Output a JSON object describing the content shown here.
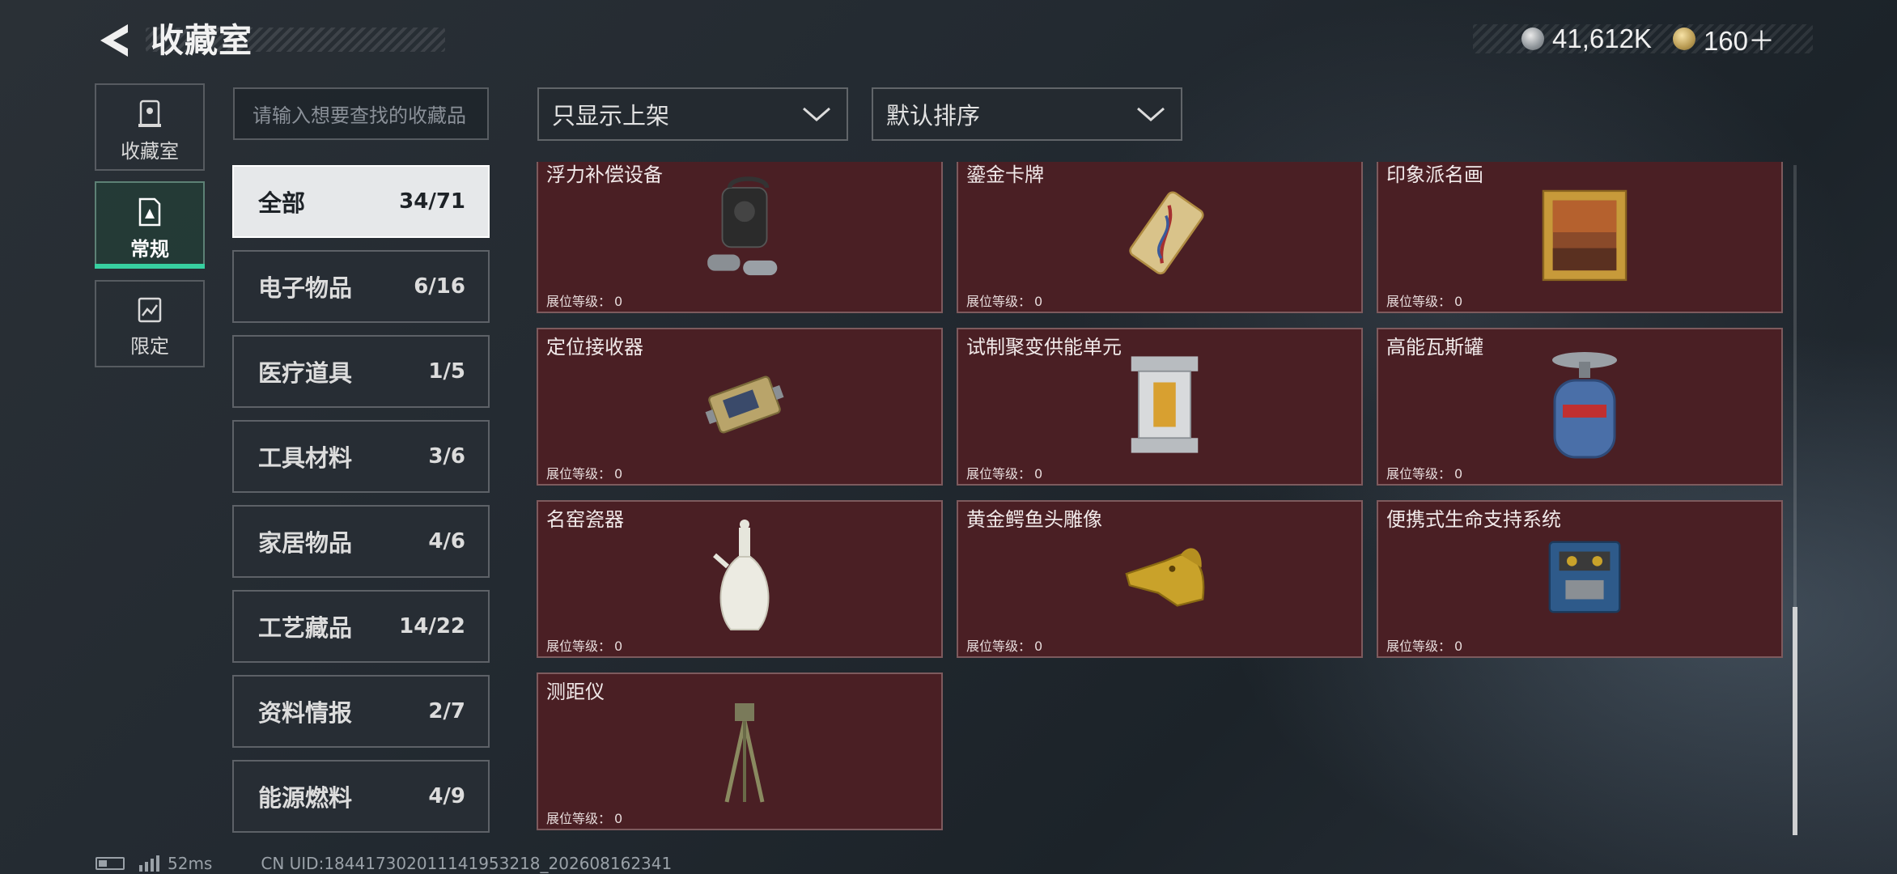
{
  "header": {
    "title": "收藏室",
    "currency": [
      {
        "icon": "silver-coin-icon",
        "value": "41,612K"
      },
      {
        "icon": "gold-coin-icon",
        "value": "160＋"
      }
    ]
  },
  "left_nav": [
    {
      "id": "collection",
      "label": "收藏室",
      "icon": "collection-icon"
    },
    {
      "id": "regular",
      "label": "常规",
      "icon": "regular-icon",
      "active": true
    },
    {
      "id": "limited",
      "label": "限定",
      "icon": "limited-icon"
    }
  ],
  "search": {
    "placeholder": "请输入想要查找的收藏品"
  },
  "filters": {
    "display": "只显示上架",
    "sort": "默认排序"
  },
  "categories": [
    {
      "name": "全部",
      "count": "34/71",
      "active": true
    },
    {
      "name": "电子物品",
      "count": "6/16"
    },
    {
      "name": "医疗道具",
      "count": "1/5"
    },
    {
      "name": "工具材料",
      "count": "3/6"
    },
    {
      "name": "家居物品",
      "count": "4/6"
    },
    {
      "name": "工艺藏品",
      "count": "14/22"
    },
    {
      "name": "资料情报",
      "count": "2/7"
    },
    {
      "name": "能源燃料",
      "count": "4/9"
    }
  ],
  "level_label": "展位等级：",
  "items": [
    {
      "name": "浮力补偿设备",
      "level": "0",
      "icon": "buoyancy-compensator-icon"
    },
    {
      "name": "鎏金卡牌",
      "level": "0",
      "icon": "gilded-card-icon"
    },
    {
      "name": "印象派名画",
      "level": "0",
      "icon": "painting-icon"
    },
    {
      "name": "定位接收器",
      "level": "0",
      "icon": "locator-receiver-icon"
    },
    {
      "name": "试制聚变供能单元",
      "level": "0",
      "icon": "fusion-power-unit-icon"
    },
    {
      "name": "高能瓦斯罐",
      "level": "0",
      "icon": "gas-canister-icon"
    },
    {
      "name": "名窑瓷器",
      "level": "0",
      "icon": "porcelain-vase-icon"
    },
    {
      "name": "黄金鳄鱼头雕像",
      "level": "0",
      "icon": "gold-crocodile-statue-icon"
    },
    {
      "name": "便携式生命支持系统",
      "level": "0",
      "icon": "life-support-system-icon"
    },
    {
      "name": "测距仪",
      "level": "0",
      "icon": "rangefinder-icon"
    }
  ],
  "footer": {
    "ping": "52ms",
    "uid": "CN UID:18441730201114195321​8_202608162341"
  },
  "colors": {
    "card_bg": "#4a1f24",
    "accent": "#37d0a0"
  }
}
